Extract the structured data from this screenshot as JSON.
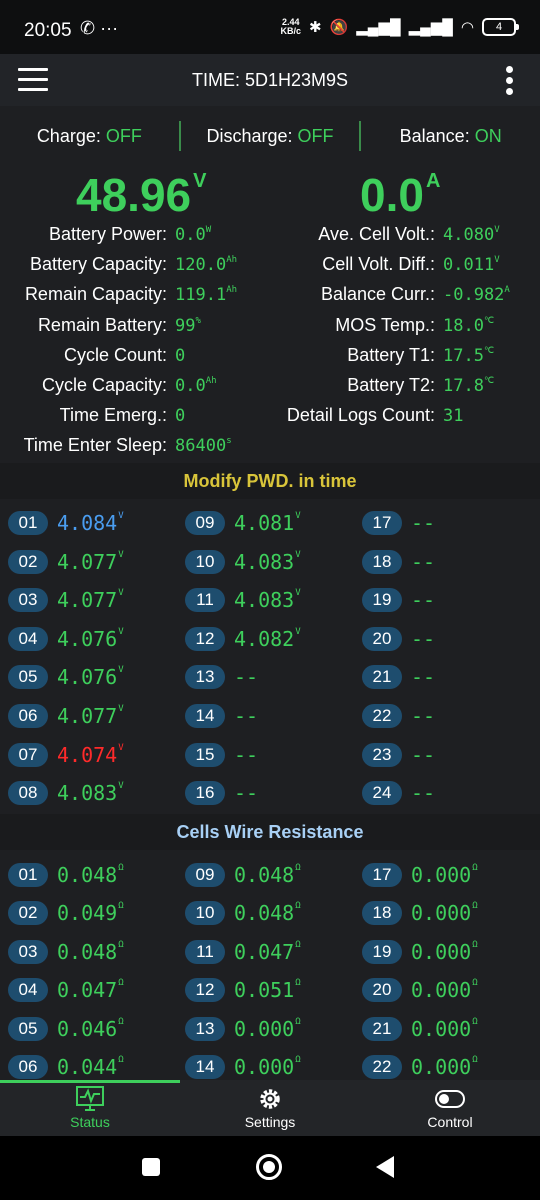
{
  "statusbar": {
    "time": "20:05",
    "speed_value": "2.44",
    "speed_unit": "KB/c",
    "battery": "4",
    "left_icons": "✆ ···"
  },
  "appbar": {
    "title": "TIME: 5D1H23M9S"
  },
  "switches": [
    {
      "label": "Charge: ",
      "value": "OFF"
    },
    {
      "label": "Discharge: ",
      "value": "OFF"
    },
    {
      "label": "Balance: ",
      "value": "ON"
    }
  ],
  "voltage": {
    "value": "48.96",
    "unit": "V"
  },
  "current": {
    "value": "0.0",
    "unit": "A"
  },
  "left_info": [
    {
      "label": "Battery Power:",
      "value": "0.0",
      "unit": "W"
    },
    {
      "label": "Battery Capacity:",
      "value": "120.0",
      "unit": "Ah"
    },
    {
      "label": "Remain Capacity:",
      "value": "119.1",
      "unit": "Ah"
    },
    {
      "label": "Remain Battery:",
      "value": "99",
      "unit": "%"
    },
    {
      "label": "Cycle Count:",
      "value": "0",
      "unit": ""
    },
    {
      "label": "Cycle Capacity:",
      "value": "0.0",
      "unit": "Ah"
    },
    {
      "label": "Time Emerg.:",
      "value": "0",
      "unit": ""
    },
    {
      "label": "Time Enter Sleep:",
      "value": "86400",
      "unit": "s"
    }
  ],
  "right_info": [
    {
      "label": "Ave. Cell Volt.:",
      "value": "4.080",
      "unit": "V"
    },
    {
      "label": "Cell Volt. Diff.:",
      "value": "0.011",
      "unit": "V"
    },
    {
      "label": "Balance Curr.:",
      "value": "-0.982",
      "unit": "A"
    },
    {
      "label": "MOS Temp.:",
      "value": "18.0",
      "unit": "℃"
    },
    {
      "label": "Battery T1:",
      "value": "17.5",
      "unit": "℃"
    },
    {
      "label": "Battery T2:",
      "value": "17.8",
      "unit": "℃"
    },
    {
      "label": "Detail Logs Count:",
      "value": "31",
      "unit": ""
    }
  ],
  "section_cells": {
    "title": "Modify PWD. in time"
  },
  "cells": [
    {
      "id": "01",
      "value": "4.084",
      "unit": "V",
      "state": "max"
    },
    {
      "id": "02",
      "value": "4.077",
      "unit": "V",
      "state": "normal"
    },
    {
      "id": "03",
      "value": "4.077",
      "unit": "V",
      "state": "normal"
    },
    {
      "id": "04",
      "value": "4.076",
      "unit": "V",
      "state": "normal"
    },
    {
      "id": "05",
      "value": "4.076",
      "unit": "V",
      "state": "normal"
    },
    {
      "id": "06",
      "value": "4.077",
      "unit": "V",
      "state": "normal"
    },
    {
      "id": "07",
      "value": "4.074",
      "unit": "V",
      "state": "min"
    },
    {
      "id": "08",
      "value": "4.083",
      "unit": "V",
      "state": "normal"
    },
    {
      "id": "09",
      "value": "4.081",
      "unit": "V",
      "state": "normal"
    },
    {
      "id": "10",
      "value": "4.083",
      "unit": "V",
      "state": "normal"
    },
    {
      "id": "11",
      "value": "4.083",
      "unit": "V",
      "state": "normal"
    },
    {
      "id": "12",
      "value": "4.082",
      "unit": "V",
      "state": "normal"
    },
    {
      "id": "13",
      "value": "--",
      "unit": "",
      "state": "normal"
    },
    {
      "id": "14",
      "value": "--",
      "unit": "",
      "state": "normal"
    },
    {
      "id": "15",
      "value": "--",
      "unit": "",
      "state": "normal"
    },
    {
      "id": "16",
      "value": "--",
      "unit": "",
      "state": "normal"
    },
    {
      "id": "17",
      "value": "--",
      "unit": "",
      "state": "normal"
    },
    {
      "id": "18",
      "value": "--",
      "unit": "",
      "state": "normal"
    },
    {
      "id": "19",
      "value": "--",
      "unit": "",
      "state": "normal"
    },
    {
      "id": "20",
      "value": "--",
      "unit": "",
      "state": "normal"
    },
    {
      "id": "21",
      "value": "--",
      "unit": "",
      "state": "normal"
    },
    {
      "id": "22",
      "value": "--",
      "unit": "",
      "state": "normal"
    },
    {
      "id": "23",
      "value": "--",
      "unit": "",
      "state": "normal"
    },
    {
      "id": "24",
      "value": "--",
      "unit": "",
      "state": "normal"
    }
  ],
  "section_resistance": {
    "title": "Cells Wire Resistance"
  },
  "resistance": [
    {
      "id": "01",
      "value": "0.048",
      "unit": "Ω"
    },
    {
      "id": "02",
      "value": "0.049",
      "unit": "Ω"
    },
    {
      "id": "03",
      "value": "0.048",
      "unit": "Ω"
    },
    {
      "id": "04",
      "value": "0.047",
      "unit": "Ω"
    },
    {
      "id": "05",
      "value": "0.046",
      "unit": "Ω"
    },
    {
      "id": "06",
      "value": "0.044",
      "unit": "Ω"
    },
    {
      "id": "09",
      "value": "0.048",
      "unit": "Ω"
    },
    {
      "id": "10",
      "value": "0.048",
      "unit": "Ω"
    },
    {
      "id": "11",
      "value": "0.047",
      "unit": "Ω"
    },
    {
      "id": "12",
      "value": "0.051",
      "unit": "Ω"
    },
    {
      "id": "13",
      "value": "0.000",
      "unit": "Ω"
    },
    {
      "id": "14",
      "value": "0.000",
      "unit": "Ω"
    },
    {
      "id": "17",
      "value": "0.000",
      "unit": "Ω"
    },
    {
      "id": "18",
      "value": "0.000",
      "unit": "Ω"
    },
    {
      "id": "19",
      "value": "0.000",
      "unit": "Ω"
    },
    {
      "id": "20",
      "value": "0.000",
      "unit": "Ω"
    },
    {
      "id": "21",
      "value": "0.000",
      "unit": "Ω"
    },
    {
      "id": "22",
      "value": "0.000",
      "unit": "Ω"
    }
  ],
  "nav": [
    {
      "label": "Status",
      "icon": "status-monitor-icon",
      "active": true
    },
    {
      "label": "Settings",
      "icon": "gear-icon",
      "active": false
    },
    {
      "label": "Control",
      "icon": "toggle-icon",
      "active": false
    }
  ],
  "colors": {
    "accent": "#3ecf5c",
    "min_cell": "#ff2a2a",
    "max_cell": "#4a9df0",
    "badge": "#1e4d6e",
    "section_cells_title": "#d9c53a",
    "section_resistance_title": "#a8d0f5"
  }
}
